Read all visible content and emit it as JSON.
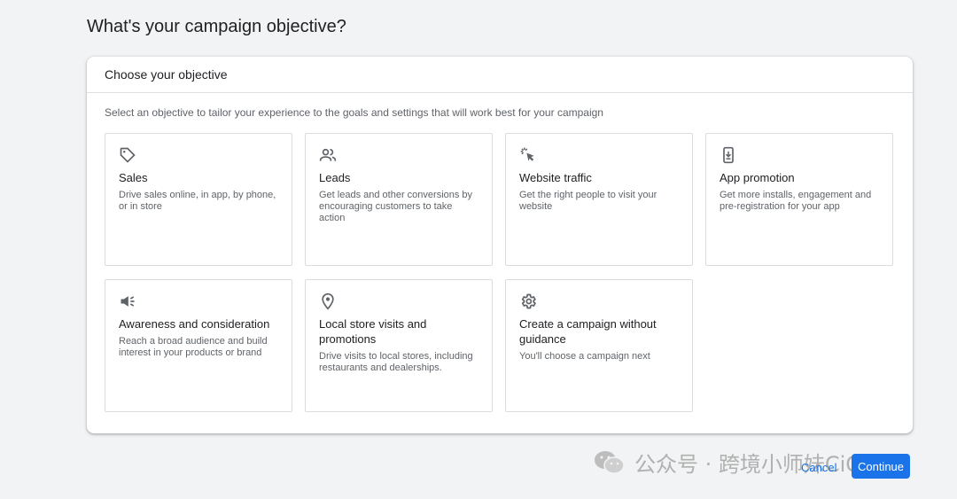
{
  "page": {
    "title": "What's your campaign objective?"
  },
  "panel": {
    "header": "Choose your objective",
    "description": "Select an objective to tailor your experience to the goals and settings that will work best for your campaign",
    "objectives": [
      {
        "icon": "tag-icon",
        "title": "Sales",
        "description": "Drive sales online, in app, by phone, or in store"
      },
      {
        "icon": "people-icon",
        "title": "Leads",
        "description": "Get leads and other conversions by encouraging customers to take action"
      },
      {
        "icon": "cursor-click-icon",
        "title": "Website traffic",
        "description": "Get the right people to visit your website"
      },
      {
        "icon": "phone-download-icon",
        "title": "App promotion",
        "description": "Get more installs, engagement and pre-registration for your app"
      },
      {
        "icon": "megaphone-icon",
        "title": "Awareness and consideration",
        "description": "Reach a broad audience and build interest in your products or brand"
      },
      {
        "icon": "location-pin-icon",
        "title": "Local store visits and promotions",
        "description": "Drive visits to local stores, including restaurants and dealerships."
      },
      {
        "icon": "gear-icon",
        "title": "Create a campaign without guidance",
        "description": "You'll choose a campaign next"
      }
    ]
  },
  "footer": {
    "cancel_label": "Cancel",
    "continue_label": "Continue"
  },
  "watermark": {
    "text": "公众号 · 跨境小师妹CiCi"
  },
  "colors": {
    "accent": "#1a73e8",
    "icon": "#5f6368",
    "border": "#dadce0"
  }
}
